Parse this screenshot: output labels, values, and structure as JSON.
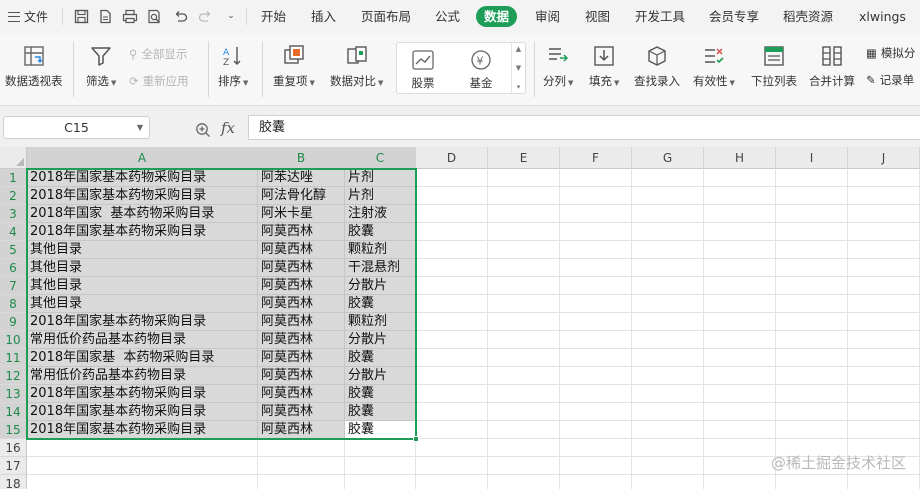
{
  "menubar": {
    "file_label": "文件",
    "tabs": [
      {
        "label": "开始"
      },
      {
        "label": "插入"
      },
      {
        "label": "页面布局"
      },
      {
        "label": "公式"
      },
      {
        "label": "数据",
        "active": true
      },
      {
        "label": "审阅"
      },
      {
        "label": "视图"
      },
      {
        "label": "开发工具"
      },
      {
        "label": "会员专享"
      },
      {
        "label": "稻壳资源"
      },
      {
        "label": "xlwings"
      }
    ]
  },
  "ribbon": {
    "pivot_label": "数据透视表",
    "filter_label": "筛选",
    "show_all_label": "全部显示",
    "reapply_label": "重新应用",
    "sort_label": "排序",
    "duplicates_label": "重复项",
    "compare_label": "数据对比",
    "stock_label": "股票",
    "fund_label": "基金",
    "split_label": "分列",
    "fill_label": "填充",
    "lookup_label": "查找录入",
    "validation_label": "有效性",
    "dropdown_label": "下拉列表",
    "consolidate_label": "合并计算",
    "whatif_label": "模拟分",
    "record_label": "记录单"
  },
  "formula_bar": {
    "name_box": "C15",
    "fx_label": "fx",
    "content": "胶囊"
  },
  "sheet": {
    "columns": [
      "A",
      "B",
      "C",
      "D",
      "E",
      "F",
      "G",
      "H",
      "I",
      "J"
    ],
    "row_numbers": [
      "1",
      "2",
      "3",
      "4",
      "5",
      "6",
      "7",
      "8",
      "9",
      "10",
      "11",
      "12",
      "13",
      "14",
      "15",
      "16",
      "17",
      "18"
    ],
    "rows": [
      [
        "2018年国家基本药物采购目录",
        "阿苯达唑",
        "片剂"
      ],
      [
        "2018年国家基本药物采购目录",
        "阿法骨化醇",
        "片剂"
      ],
      [
        "2018年国家  基本药物采购目录",
        "阿米卡星",
        "注射液"
      ],
      [
        "2018年国家基本药物采购目录",
        "阿莫西林",
        "胶囊"
      ],
      [
        "其他目录",
        "阿莫西林",
        "颗粒剂"
      ],
      [
        "其他目录",
        "阿莫西林",
        "干混悬剂"
      ],
      [
        "其他目录",
        "阿莫西林",
        "分散片"
      ],
      [
        "其他目录",
        "阿莫西林",
        "胶囊"
      ],
      [
        "2018年国家基本药物采购目录",
        "阿莫西林",
        "颗粒剂"
      ],
      [
        "常用低价药品基本药物目录",
        "阿莫西林",
        "分散片"
      ],
      [
        "2018年国家基  本药物采购目录",
        "阿莫西林",
        "胶囊"
      ],
      [
        "常用低价药品基本药物目录",
        "阿莫西林",
        "分散片"
      ],
      [
        "2018年国家基本药物采购目录",
        "阿莫西林",
        "胶囊"
      ],
      [
        "2018年国家基本药物采购目录",
        "阿莫西林",
        "胶囊"
      ],
      [
        "2018年国家基本药物采购目录",
        "阿莫西林",
        "胶囊"
      ]
    ]
  },
  "watermark": "@稀土掘金技术社区"
}
